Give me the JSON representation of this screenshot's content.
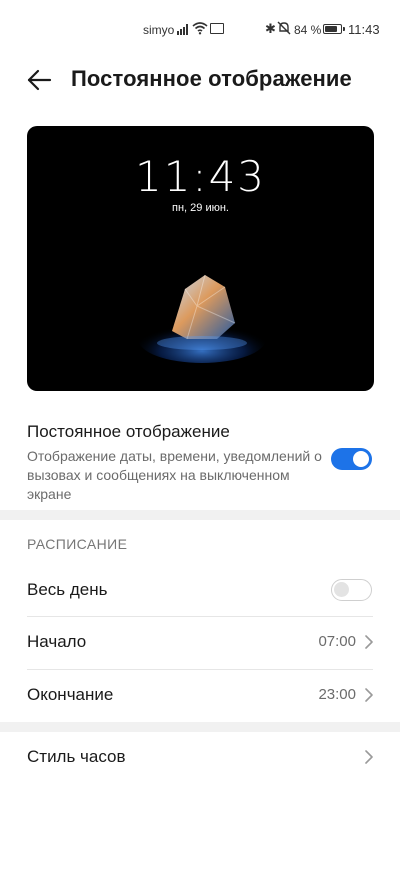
{
  "status_bar": {
    "carrier": "simyo",
    "bluetooth_glyph": "✱",
    "battery_percent": "84 %",
    "battery_level": 0.84,
    "time": "11:43",
    "icons": [
      "signal-icon",
      "wifi-icon",
      "mail-icon",
      "bluetooth-icon",
      "mute-icon",
      "battery-icon"
    ]
  },
  "header": {
    "back_icon": "back-arrow-icon",
    "title": "Постоянное отображение"
  },
  "preview": {
    "clock": "11:43",
    "date": "пн, 29 июн."
  },
  "aod_toggle": {
    "title": "Постоянное отображение",
    "description": "Отображение даты, времени, уведомлений о вызовах и сообщениях на выключенном экране",
    "enabled": true
  },
  "schedule": {
    "section_title": "РАСПИСАНИЕ",
    "all_day": {
      "label": "Весь день",
      "enabled": false
    },
    "start": {
      "label": "Начало",
      "value": "07:00"
    },
    "end": {
      "label": "Окончание",
      "value": "23:00"
    }
  },
  "clock_style": {
    "label": "Стиль часов"
  },
  "colors": {
    "accent": "#1d73e8",
    "text_primary": "#1a1a1a",
    "text_secondary": "#6b6b6b",
    "band": "#f1f1f1"
  }
}
